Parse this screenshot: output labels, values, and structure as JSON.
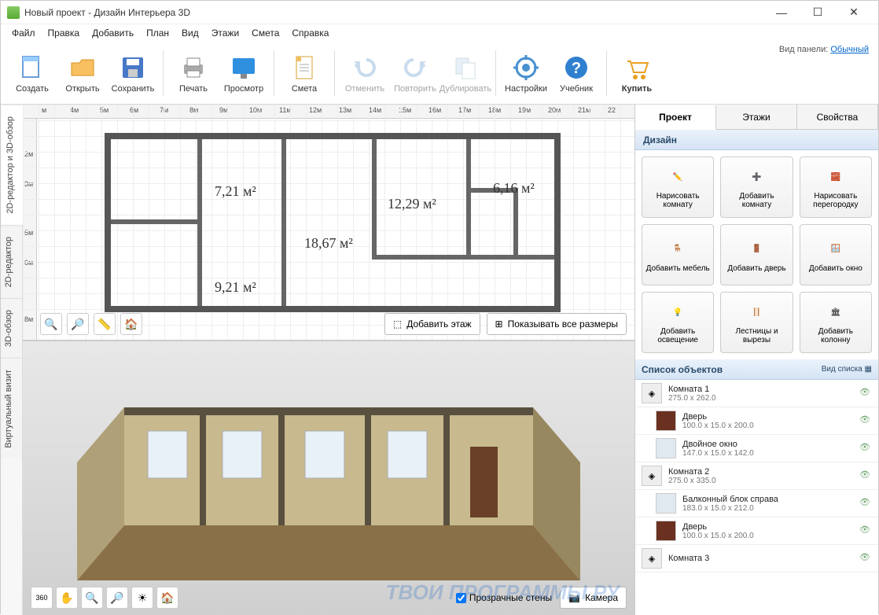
{
  "window": {
    "title": "Новый проект - Дизайн Интерьера 3D"
  },
  "menu": {
    "items": [
      "Файл",
      "Правка",
      "Добавить",
      "План",
      "Вид",
      "Этажи",
      "Смета",
      "Справка"
    ]
  },
  "toolbar": {
    "panel_mode_label": "Вид панели:",
    "panel_mode_value": "Обычный",
    "buttons": {
      "create": "Создать",
      "open": "Открыть",
      "save": "Сохранить",
      "print": "Печать",
      "preview": "Просмотр",
      "estimate": "Смета",
      "undo": "Отменить",
      "redo": "Повторить",
      "duplicate": "Дублировать",
      "settings": "Настройки",
      "tutorial": "Учебник",
      "buy": "Купить"
    }
  },
  "vtabs": {
    "t1": "2D-редактор и 3D-обзор",
    "t2": "2D-редактор",
    "t3": "3D-обзор",
    "t4": "Виртуальный визит"
  },
  "ruler_h": [
    "м",
    "4м",
    "5м",
    "6м",
    "7м",
    "8м",
    "9м",
    "10м",
    "11м",
    "12м",
    "13м",
    "14м",
    "15м",
    "16м",
    "17м",
    "18м",
    "19м",
    "20м",
    "21м",
    "22"
  ],
  "ruler_v": [
    "2м",
    "3м",
    "5м",
    "6м",
    "8м"
  ],
  "rooms": {
    "r1": "7,21 м²",
    "r2": "18,67 м²",
    "r3": "12,29 м²",
    "r4": "6,16 м²",
    "r5": "9,21 м²"
  },
  "plan_actions": {
    "add_floor": "Добавить этаж",
    "show_sizes": "Показывать все размеры"
  },
  "view3d_controls": {
    "transparent_walls": "Прозрачные стены",
    "camera": "Камера"
  },
  "rtabs": {
    "project": "Проект",
    "floors": "Этажи",
    "props": "Свойства"
  },
  "sections": {
    "design": "Дизайн",
    "objects": "Список объектов",
    "view_mode": "Вид списка"
  },
  "design_buttons": {
    "draw_room": "Нарисовать комнату",
    "add_room": "Добавить комнату",
    "draw_partition": "Нарисовать перегородку",
    "add_furniture": "Добавить мебель",
    "add_door": "Добавить дверь",
    "add_window": "Добавить окно",
    "add_light": "Добавить освещение",
    "stairs": "Лестницы и вырезы",
    "add_column": "Добавить колонну"
  },
  "objects": [
    {
      "name": "Комната 1",
      "size": "275.0 x 262.0",
      "type": "room"
    },
    {
      "name": "Дверь",
      "size": "100.0 x 15.0 x 200.0",
      "type": "door"
    },
    {
      "name": "Двойное окно",
      "size": "147.0 x 15.0 x 142.0",
      "type": "window"
    },
    {
      "name": "Комната 2",
      "size": "275.0 x 335.0",
      "type": "room"
    },
    {
      "name": "Балконный блок справа",
      "size": "183.0 x 15.0 x 212.0",
      "type": "window"
    },
    {
      "name": "Дверь",
      "size": "100.0 x 15.0 x 200.0",
      "type": "door"
    },
    {
      "name": "Комната 3",
      "size": "",
      "type": "room"
    }
  ],
  "watermark": "ТВОИ ПРОГРАММЫ РУ"
}
